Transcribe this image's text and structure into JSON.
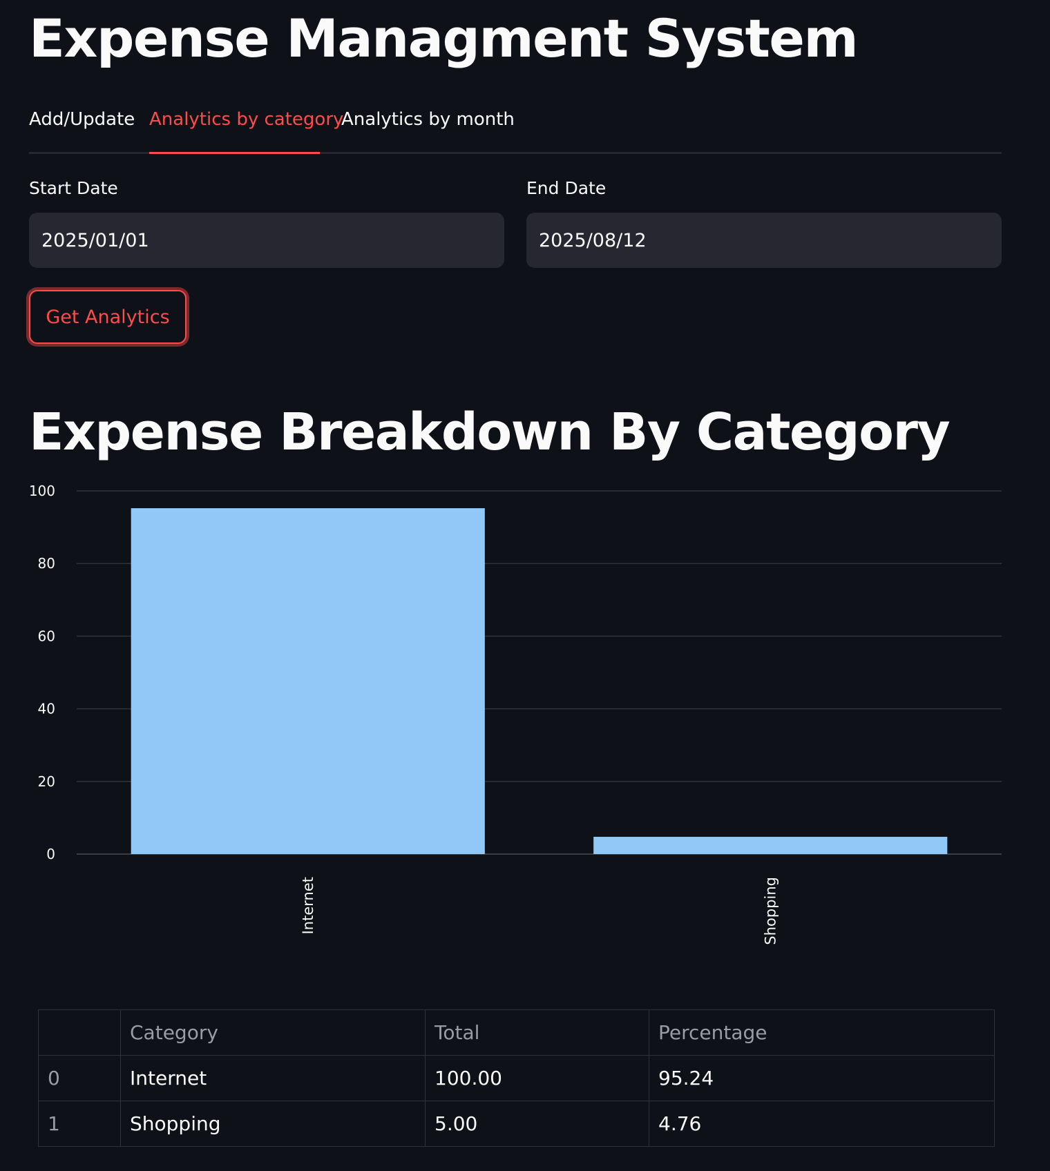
{
  "title": "Expense Managment System",
  "tabs": [
    {
      "label": "Add/Update",
      "active": false
    },
    {
      "label": "Analytics by category",
      "active": true
    },
    {
      "label": "Analytics by month",
      "active": false
    }
  ],
  "form": {
    "start_label": "Start Date",
    "start_value": "2025/01/01",
    "end_label": "End Date",
    "end_value": "2025/08/12",
    "button_label": "Get Analytics"
  },
  "section_title": "Expense Breakdown By Category",
  "colors": {
    "accent": "#ff4b4b",
    "bar": "#90c8f8",
    "background": "#0e1117",
    "input_bg": "#262730"
  },
  "chart_data": {
    "type": "bar",
    "categories": [
      "Internet",
      "Shopping"
    ],
    "values": [
      95.24,
      4.76
    ],
    "yticks": [
      0,
      20,
      40,
      60,
      80,
      100
    ],
    "ylim": [
      0,
      100
    ],
    "grid": true,
    "title": "",
    "xlabel": "",
    "ylabel": ""
  },
  "table": {
    "columns": [
      "",
      "Category",
      "Total",
      "Percentage"
    ],
    "rows": [
      [
        "0",
        "Internet",
        "100.00",
        "95.24"
      ],
      [
        "1",
        "Shopping",
        "5.00",
        "4.76"
      ]
    ]
  }
}
